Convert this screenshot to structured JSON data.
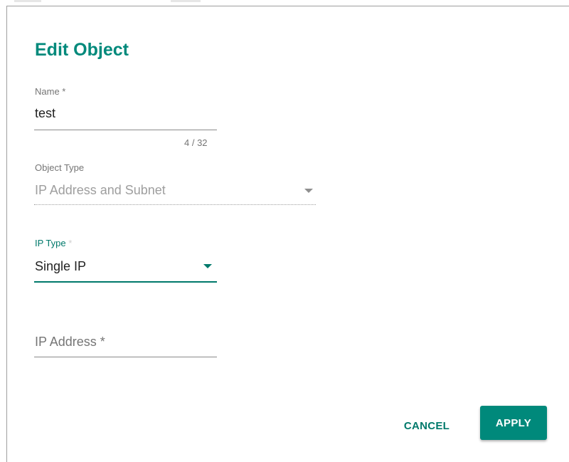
{
  "dialog": {
    "title": "Edit Object",
    "name_field": {
      "label": "Name *",
      "value": "test",
      "counter": "4 / 32"
    },
    "object_type_field": {
      "label": "Object Type",
      "value": "IP Address and Subnet",
      "disabled": true
    },
    "ip_type_field": {
      "label": "IP Type",
      "required_mark": "*",
      "value": "Single IP"
    },
    "ip_address_field": {
      "placeholder": "IP Address *",
      "value": ""
    },
    "actions": {
      "cancel_label": "CANCEL",
      "apply_label": "APPLY"
    }
  },
  "colors": {
    "accent": "#00897b",
    "accent_dark": "#00796b",
    "label_grey": "#757575",
    "disabled_grey": "#9e9e9e"
  },
  "icons": {
    "dropdown": "caret-down-icon"
  }
}
